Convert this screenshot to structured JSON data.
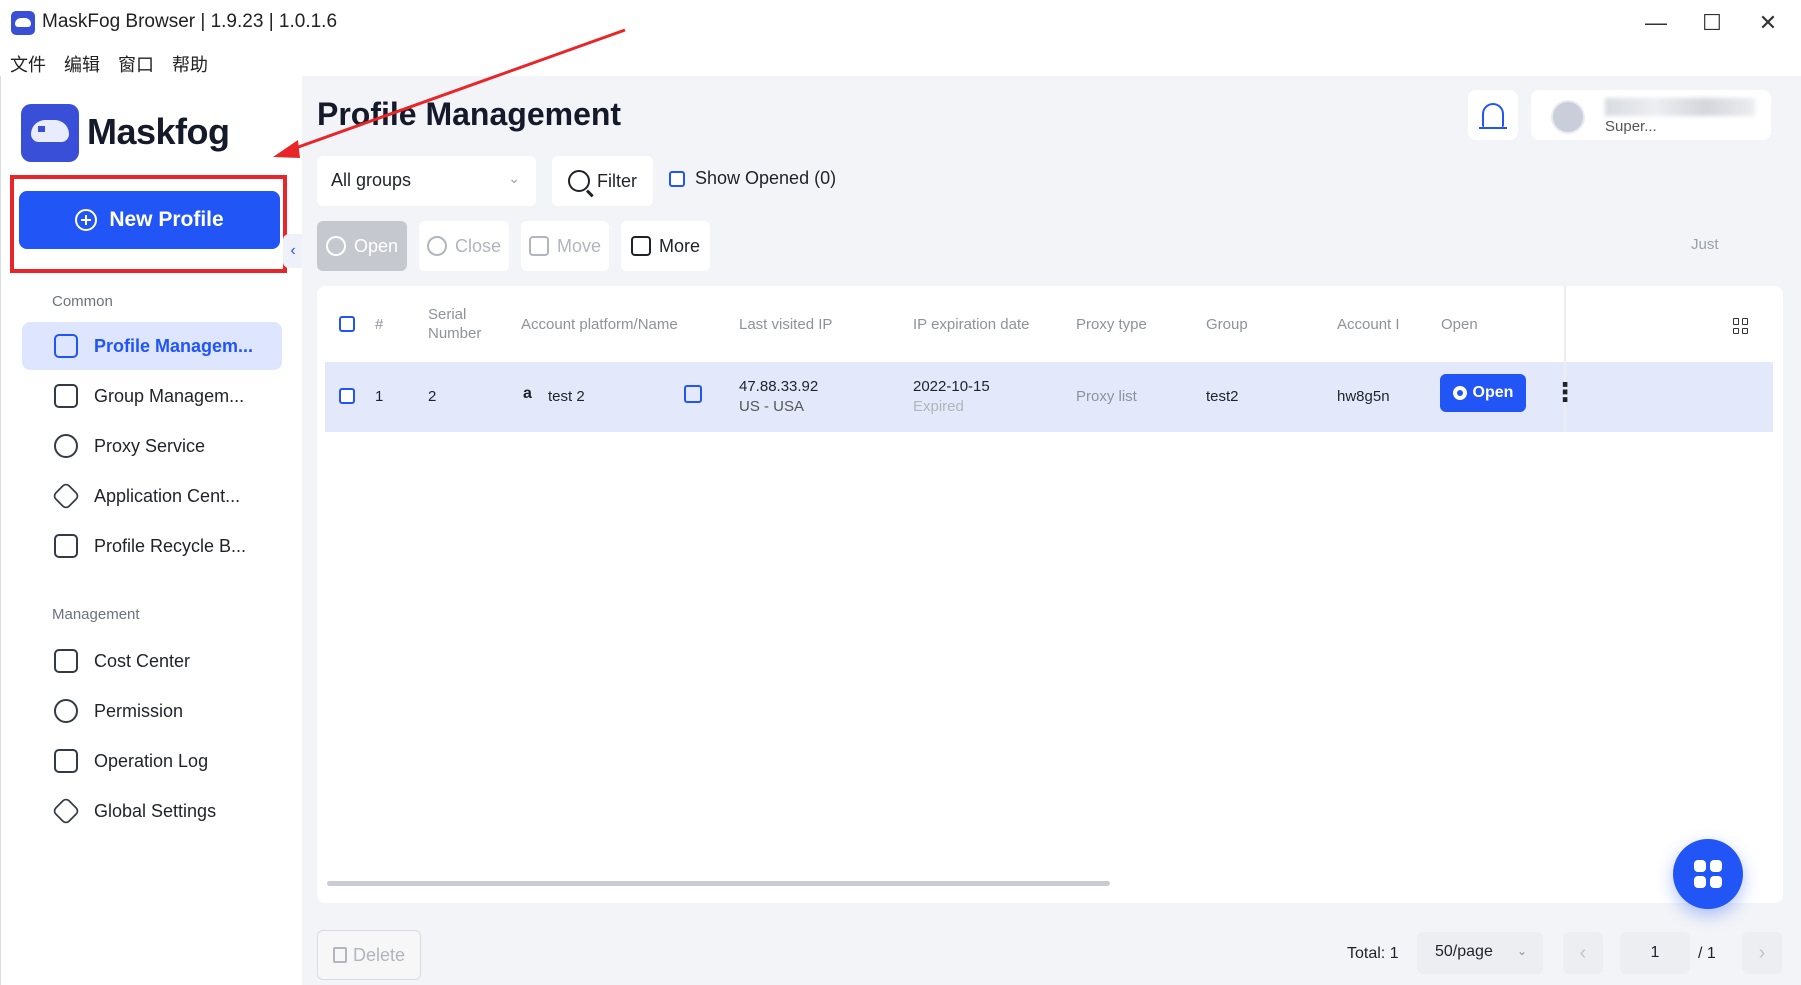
{
  "window": {
    "title": "MaskFog Browser | 1.9.23 | 1.0.1.6",
    "minimize_glyph": "—",
    "maximize_glyph": "☐",
    "close_glyph": "✕"
  },
  "menubar": [
    "文件",
    "编辑",
    "窗口",
    "帮助"
  ],
  "sidebar": {
    "brand": "Maskfog",
    "new_profile_label": "New Profile",
    "collapse_glyph": "‹",
    "sections": [
      {
        "title": "Common",
        "items": [
          {
            "label": "Profile Managem...",
            "icon": "folder-icon",
            "active": true
          },
          {
            "label": "Group Managem...",
            "icon": "folder-open-icon"
          },
          {
            "label": "Proxy Service",
            "icon": "location-pin-icon"
          },
          {
            "label": "Application Cent...",
            "icon": "cube-icon"
          },
          {
            "label": "Profile Recycle B...",
            "icon": "trash-icon"
          }
        ]
      },
      {
        "title": "Management",
        "items": [
          {
            "label": "Cost Center",
            "icon": "receipt-icon"
          },
          {
            "label": "Permission",
            "icon": "shield-icon"
          },
          {
            "label": "Operation Log",
            "icon": "clipboard-icon"
          },
          {
            "label": "Global Settings",
            "icon": "settings-hexagon-icon"
          }
        ]
      }
    ]
  },
  "header": {
    "title": "Profile Management",
    "user_name": "Super..."
  },
  "filters": {
    "group_select": "All groups",
    "filter_label": "Filter",
    "show_opened_label": "Show Opened (0)"
  },
  "toolbar": {
    "open": "Open",
    "close": "Close",
    "move": "Move",
    "more": "More",
    "just": "Just"
  },
  "table": {
    "columns": [
      "#",
      "Serial Number",
      "Account platform/Name",
      "Last visited IP",
      "IP expiration date",
      "Proxy type",
      "Group",
      "Account I",
      "Open"
    ],
    "rows": [
      {
        "index": "1",
        "serial": "2",
        "platform_glyph": "a",
        "name": "test 2",
        "ip": "47.88.33.92",
        "ip_location": "US - USA",
        "expiration_date": "2022-10-15",
        "expiration_status": "Expired",
        "proxy_type": "Proxy list",
        "group": "test2",
        "account_id": "hw8g5n",
        "open_label": "Open",
        "more_glyph": "⋮"
      }
    ]
  },
  "footer": {
    "delete_label": "Delete",
    "total": "Total: 1",
    "page_size": "50/page",
    "current_page": "1",
    "page_total": "/ 1"
  },
  "colors": {
    "accent": "#2155f5",
    "highlight_box": "#e8262a",
    "sidebar_active": "#dde5ff",
    "row_selected": "#e3e9fb"
  }
}
